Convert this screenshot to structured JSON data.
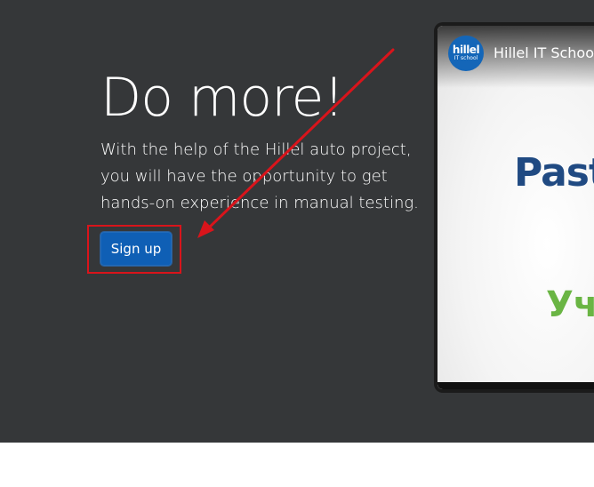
{
  "hero": {
    "title": "Do more!",
    "description_lines": [
      "With the help of the Hillel auto project,",
      "you will have the opportunity to get",
      "hands-on experience in manual testing."
    ],
    "signup_label": "Sign up"
  },
  "video": {
    "channel_logo_main": "hillel",
    "channel_logo_sub": "IT school",
    "title": "Hillel IT School",
    "frame_text_1": "Past",
    "frame_text_2": "Уч"
  },
  "colors": {
    "hero_background": "#353739",
    "button": "#0f5fb5",
    "annotation": "#d9141b"
  },
  "icons": {
    "annotation_arrow": "arrow-icon",
    "channel_logo": "hillel-logo-icon"
  }
}
